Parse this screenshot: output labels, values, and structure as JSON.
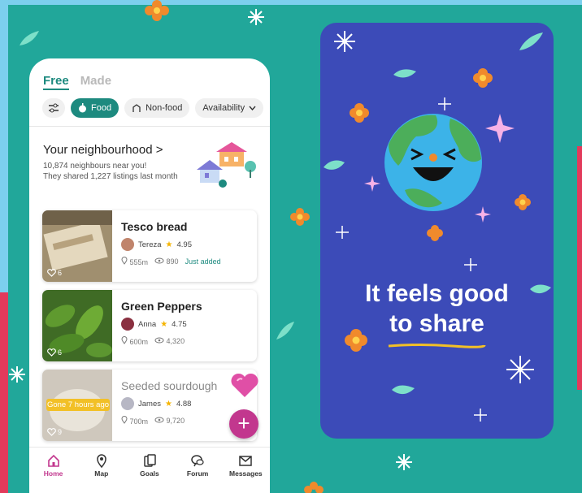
{
  "feed_tabs": [
    {
      "label": "Free",
      "active": true
    },
    {
      "label": "Made",
      "active": false
    }
  ],
  "filters": {
    "filter_icon": "sliders-icon",
    "chips": [
      {
        "label": "Food",
        "icon": "apple-icon",
        "active": true
      },
      {
        "label": "Non-food",
        "icon": "box-icon",
        "active": false
      },
      {
        "label": "Availability",
        "icon": "chevron-down-icon",
        "active": false
      }
    ]
  },
  "neighbourhood": {
    "title": "Your neighbourhood",
    "chevron": ">",
    "neighbours_text": "10,874 neighbours near you!",
    "listings_text": "They shared 1,227 listings last month"
  },
  "listings": [
    {
      "title": "Tesco bread",
      "user": "Tereza",
      "rating": "4.95",
      "distance": "555m",
      "views": "890",
      "status": "Just added",
      "likes": "6"
    },
    {
      "title": "Green Peppers",
      "user": "Anna",
      "rating": "4.75",
      "distance": "600m",
      "views": "4,320",
      "likes": "6"
    },
    {
      "title": "Seeded sourdough",
      "user": "James",
      "rating": "4.88",
      "distance": "700m",
      "views": "9,720",
      "likes": "9",
      "badge": "Gone 7 hours ago"
    }
  ],
  "fab": {
    "label": "+"
  },
  "bottom_nav": [
    {
      "label": "Home",
      "icon": "home-icon",
      "active": true
    },
    {
      "label": "Map",
      "icon": "map-pin-icon",
      "active": false
    },
    {
      "label": "Goals",
      "icon": "goals-icon",
      "active": false
    },
    {
      "label": "Forum",
      "icon": "chat-icon",
      "active": false
    },
    {
      "label": "Messages",
      "icon": "envelope-icon",
      "active": false
    }
  ],
  "promo": {
    "line1": "It feels good",
    "line2": "to share"
  },
  "colors": {
    "background": "#21a79a",
    "brand": "#1d8a7f",
    "accent": "#c2378e",
    "promo_bg": "#3c4bb8",
    "star": "#f5b400"
  }
}
